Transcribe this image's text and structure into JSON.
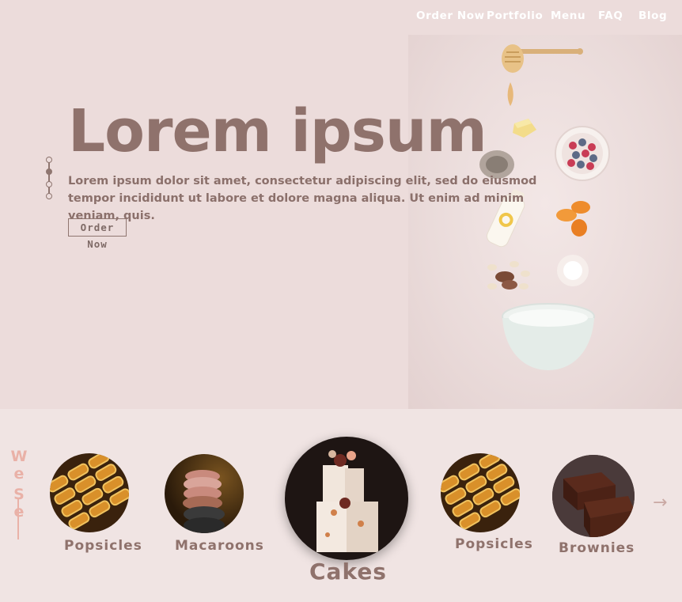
{
  "nav": {
    "items": [
      "Order Now",
      "Portfolio",
      "Menu",
      "FAQ",
      "Blog"
    ]
  },
  "hero": {
    "title": "Lorem ipsum",
    "paragraph": "Lorem ipsum dolor sit amet, consectetur adipiscing elit, sed do eiusmod tempor incididunt ut labore et dolore magna aliqua. Ut enim ad minim  veniam, quis.",
    "cta_label": "Order Now",
    "pager_active": 2,
    "pager_count": 4
  },
  "section": {
    "label_letters": [
      "W",
      "e",
      "S",
      "e"
    ]
  },
  "products": [
    {
      "name": "Popsicles"
    },
    {
      "name": "Macaroons"
    },
    {
      "name": "Cakes"
    },
    {
      "name": "Popsicles"
    },
    {
      "name": "Brownies"
    }
  ],
  "colors": {
    "accent": "#8f726c",
    "background": "#ecdcdb",
    "label_pink": "#e9b1a7"
  },
  "icons": {
    "next": "arrow-right-icon"
  }
}
